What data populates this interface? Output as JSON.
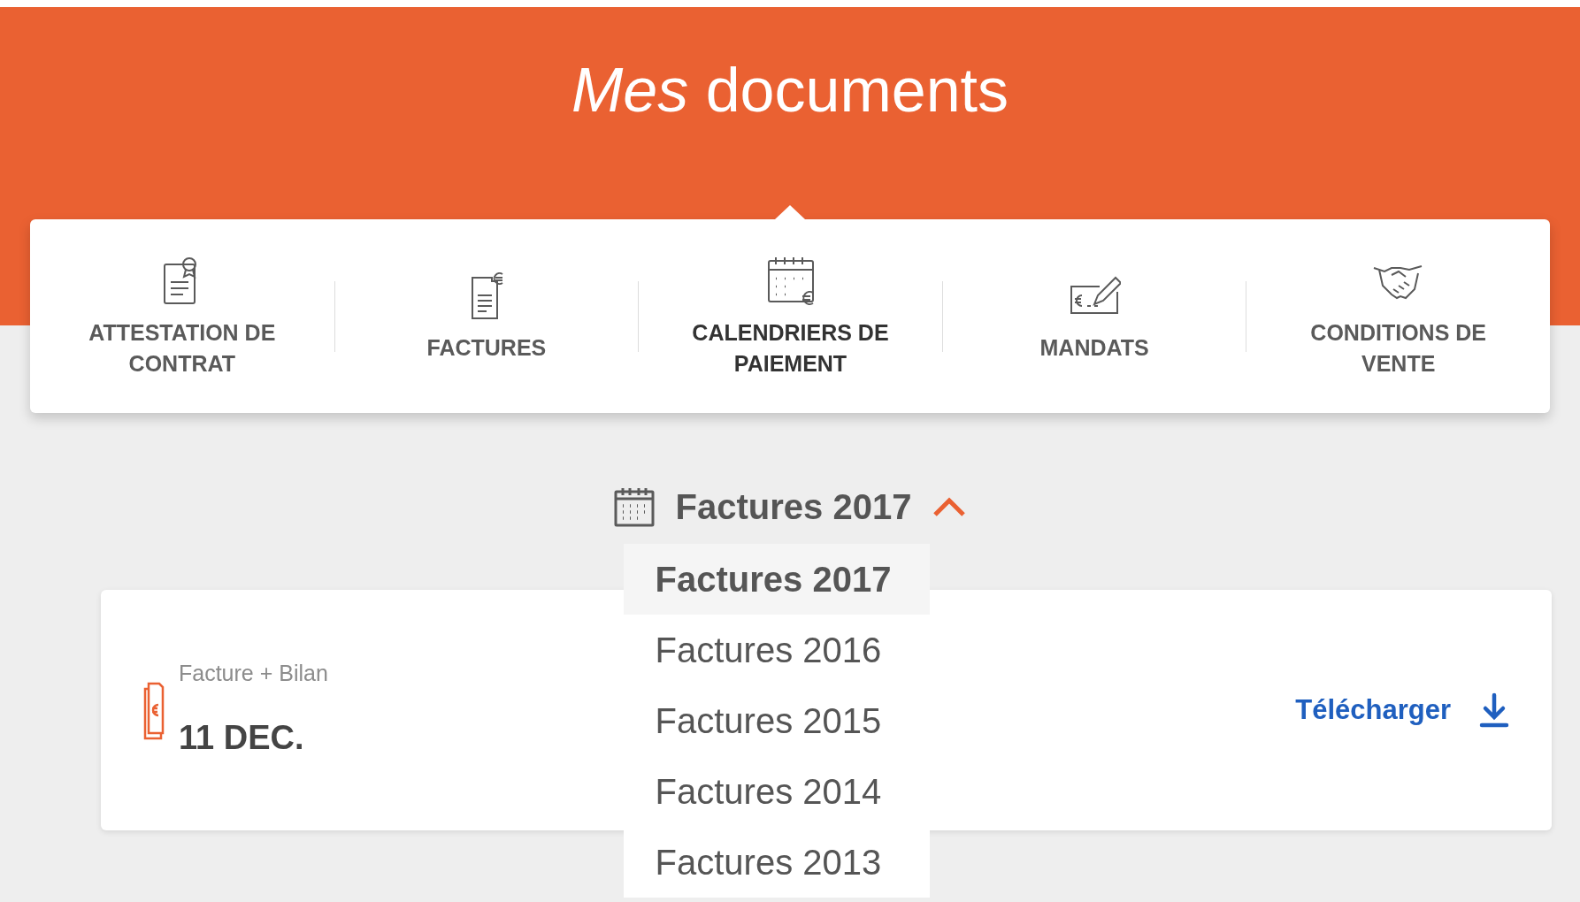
{
  "header": {
    "title": "*Mes* documents"
  },
  "tabs": [
    {
      "kind": "certificate",
      "label": "ATTESTATION DE CONTRAT",
      "selected": false
    },
    {
      "kind": "invoice",
      "label": "FACTURES",
      "selected": false
    },
    {
      "kind": "calendar",
      "label": "CALENDRIERS DE PAIEMENT",
      "selected": true
    },
    {
      "kind": "cheque",
      "label": "MANDATS",
      "selected": false
    },
    {
      "kind": "handshake",
      "label": "CONDITIONS DE VENTE",
      "selected": false
    }
  ],
  "year_select": {
    "value": "Factures 2017",
    "expanded": true,
    "options": [
      {
        "label": "Factures 2017",
        "selected": true
      },
      {
        "label": "Factures 2016",
        "selected": false
      },
      {
        "label": "Factures 2015",
        "selected": false
      },
      {
        "label": "Factures 2014",
        "selected": false
      },
      {
        "label": "Factures 2013",
        "selected": false
      }
    ]
  },
  "documents": [
    {
      "type": "Facture + Bilan",
      "date": "11 DEC.",
      "action": "Télécharger"
    }
  ]
}
